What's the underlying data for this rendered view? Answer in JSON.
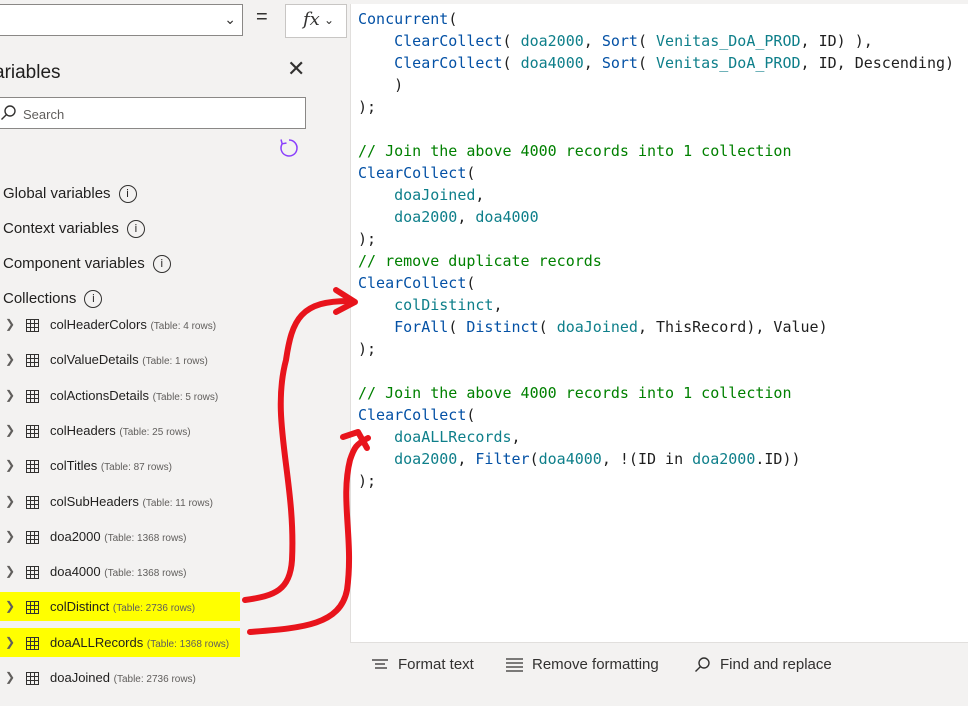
{
  "formula_bar": {
    "equals": "=",
    "fx_label": "fx"
  },
  "panel": {
    "title": "ariables",
    "search_placeholder": "Search",
    "sections": [
      {
        "label": "Global variables"
      },
      {
        "label": "Context variables"
      },
      {
        "label": "Component variables"
      },
      {
        "label": "Collections"
      }
    ],
    "info_glyph": "i",
    "collections": [
      {
        "name": "colHeaderColors",
        "meta": "(Table: 4 rows)",
        "highlighted": false
      },
      {
        "name": "colValueDetails",
        "meta": "(Table: 1 rows)",
        "highlighted": false
      },
      {
        "name": "colActionsDetails",
        "meta": "(Table: 5 rows)",
        "highlighted": false
      },
      {
        "name": "colHeaders",
        "meta": "(Table: 25 rows)",
        "highlighted": false
      },
      {
        "name": "colTitles",
        "meta": "(Table: 87 rows)",
        "highlighted": false
      },
      {
        "name": "colSubHeaders",
        "meta": "(Table: 11 rows)",
        "highlighted": false
      },
      {
        "name": "doa2000",
        "meta": "(Table: 1368 rows)",
        "highlighted": false
      },
      {
        "name": "doa4000",
        "meta": "(Table: 1368 rows)",
        "highlighted": false
      },
      {
        "name": "colDistinct",
        "meta": "(Table: 2736 rows)",
        "highlighted": true
      },
      {
        "name": "doaALLRecords",
        "meta": "(Table: 1368 rows)",
        "highlighted": true
      },
      {
        "name": "doaJoined",
        "meta": "(Table: 2736 rows)",
        "highlighted": false
      }
    ]
  },
  "code_lines": [
    [
      [
        "f",
        "Concurrent"
      ],
      [
        "p",
        "("
      ]
    ],
    [
      [
        "p",
        "    "
      ],
      [
        "f",
        "ClearCollect"
      ],
      [
        "p",
        "( "
      ],
      [
        "v",
        "doa2000"
      ],
      [
        "p",
        ", "
      ],
      [
        "f",
        "Sort"
      ],
      [
        "p",
        "( "
      ],
      [
        "v",
        "Venitas_DoA_PROD"
      ],
      [
        "p",
        ", ID) ),"
      ]
    ],
    [
      [
        "p",
        "    "
      ],
      [
        "f",
        "ClearCollect"
      ],
      [
        "p",
        "( "
      ],
      [
        "v",
        "doa4000"
      ],
      [
        "p",
        ", "
      ],
      [
        "f",
        "Sort"
      ],
      [
        "p",
        "( "
      ],
      [
        "v",
        "Venitas_DoA_PROD"
      ],
      [
        "p",
        ", ID, Descending)"
      ]
    ],
    [
      [
        "p",
        "    )"
      ]
    ],
    [
      [
        "p",
        ");"
      ]
    ],
    [
      [
        "p",
        ""
      ]
    ],
    [
      [
        "c",
        "// Join the above 4000 records into 1 collection"
      ]
    ],
    [
      [
        "f",
        "ClearCollect"
      ],
      [
        "p",
        "("
      ]
    ],
    [
      [
        "p",
        "    "
      ],
      [
        "v",
        "doaJoined"
      ],
      [
        "p",
        ","
      ]
    ],
    [
      [
        "p",
        "    "
      ],
      [
        "v",
        "doa2000"
      ],
      [
        "p",
        ", "
      ],
      [
        "v",
        "doa4000"
      ]
    ],
    [
      [
        "p",
        ");"
      ]
    ],
    [
      [
        "c",
        "// remove duplicate records"
      ]
    ],
    [
      [
        "f",
        "ClearCollect"
      ],
      [
        "p",
        "("
      ]
    ],
    [
      [
        "p",
        "    "
      ],
      [
        "v",
        "colDistinct"
      ],
      [
        "p",
        ","
      ]
    ],
    [
      [
        "p",
        "    "
      ],
      [
        "f",
        "ForAll"
      ],
      [
        "p",
        "( "
      ],
      [
        "f",
        "Distinct"
      ],
      [
        "p",
        "( "
      ],
      [
        "v",
        "doaJoined"
      ],
      [
        "p",
        ", ThisRecord), Value)"
      ]
    ],
    [
      [
        "p",
        ");"
      ]
    ],
    [
      [
        "p",
        ""
      ]
    ],
    [
      [
        "c",
        "// Join the above 4000 records into 1 collection"
      ]
    ],
    [
      [
        "f",
        "ClearCollect"
      ],
      [
        "p",
        "("
      ]
    ],
    [
      [
        "p",
        "    "
      ],
      [
        "v",
        "doaALLRecords"
      ],
      [
        "p",
        ","
      ]
    ],
    [
      [
        "p",
        "    "
      ],
      [
        "v",
        "doa2000"
      ],
      [
        "p",
        ", "
      ],
      [
        "f",
        "Filter"
      ],
      [
        "p",
        "("
      ],
      [
        "v",
        "doa4000"
      ],
      [
        "p",
        ", !(ID in "
      ],
      [
        "v",
        "doa2000"
      ],
      [
        "p",
        ".ID))"
      ]
    ],
    [
      [
        "p",
        ");"
      ]
    ]
  ],
  "toolbar": {
    "format_text": "Format text",
    "remove_formatting": "Remove formatting",
    "find_replace": "Find and replace"
  },
  "colors": {
    "highlight": "#ffff00",
    "annotation_arrow": "#e8141c",
    "comment": "#008000",
    "function": "#0451a5",
    "variable": "#0e7f8a",
    "refresh_icon": "#8a3ffc"
  }
}
